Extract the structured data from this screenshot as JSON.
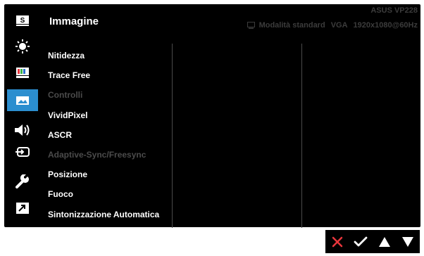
{
  "header": {
    "title": "Immagine",
    "model": "ASUS  VP228",
    "mode": "Modalità standard",
    "input": "VGA",
    "resolution": "1920x1080@60Hz"
  },
  "sidebar": {
    "items": [
      {
        "icon": "splendid-s-icon",
        "active": false
      },
      {
        "icon": "brightness-sun-icon",
        "active": false
      },
      {
        "icon": "color-bars-icon",
        "active": false
      },
      {
        "icon": "image-picture-icon",
        "active": true
      },
      {
        "icon": "sound-speaker-icon",
        "active": false
      },
      {
        "icon": "input-select-icon",
        "active": false
      },
      {
        "icon": "system-setup-wrench-icon",
        "active": false
      },
      {
        "icon": "shortcut-arrow-icon",
        "active": false
      }
    ]
  },
  "menu": {
    "items": [
      {
        "label": "Nitidezza",
        "enabled": true
      },
      {
        "label": "Trace Free",
        "enabled": true
      },
      {
        "label": "Controlli",
        "enabled": false
      },
      {
        "label": "VividPixel",
        "enabled": true
      },
      {
        "label": "ASCR",
        "enabled": true
      },
      {
        "label": "Adaptive-Sync/Freesync",
        "enabled": false
      },
      {
        "label": "Posizione",
        "enabled": true
      },
      {
        "label": "Fuoco",
        "enabled": true
      },
      {
        "label": "Sintonizzazione Automatica",
        "enabled": true
      }
    ]
  },
  "nav_buttons": [
    "close-x-icon",
    "check-icon",
    "triangle-up-icon",
    "triangle-down-icon"
  ],
  "colors": {
    "background": "#000000",
    "accent": "#2b8ecf",
    "text": "#ffffff",
    "disabled_text": "#4b4b4b",
    "status_text": "#3c3c3c",
    "close_red": "#e8363c"
  }
}
